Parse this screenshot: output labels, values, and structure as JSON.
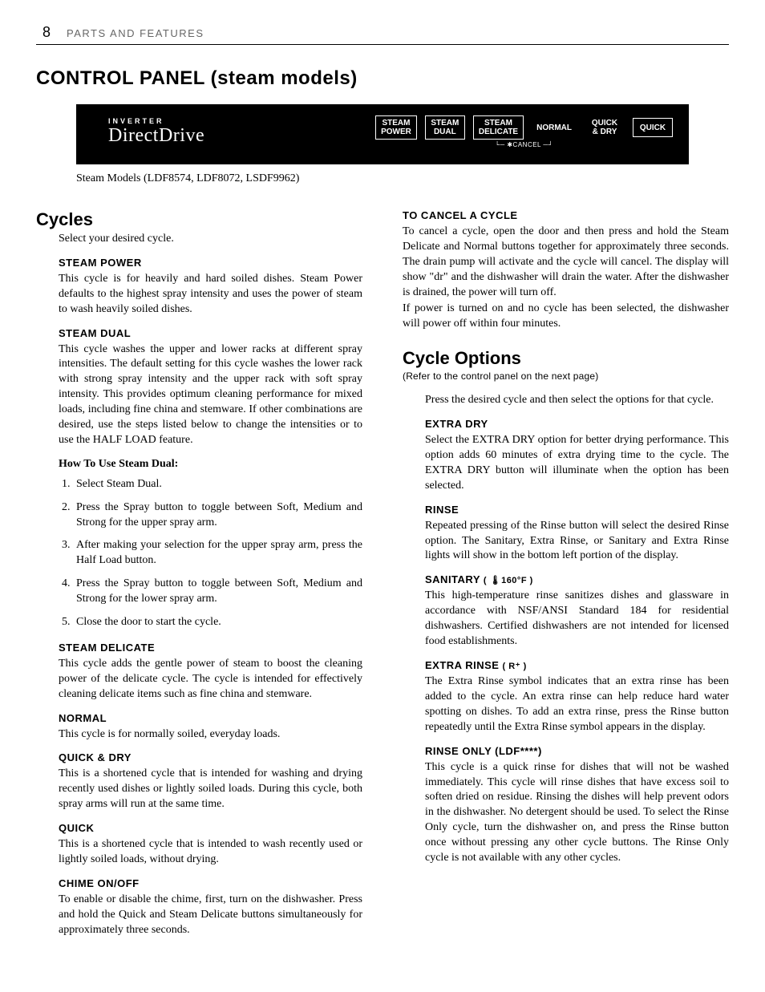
{
  "header": {
    "page_number": "8",
    "section": "PARTS AND FEATURES"
  },
  "title": "CONTROL PANEL (steam models)",
  "panel": {
    "brand_top": "INVERTER",
    "brand_main": "DirectDrive",
    "buttons": {
      "b1a": "STEAM",
      "b1b": "POWER",
      "b2a": "STEAM",
      "b2b": "DUAL",
      "b3a": "STEAM",
      "b3b": "DELICATE",
      "b4": "NORMAL",
      "b5a": "QUICK",
      "b5b": "& DRY",
      "b6": "QUICK"
    },
    "cancel": "✱CANCEL"
  },
  "caption": "Steam Models (LDF8574, LDF8072, LSDF9962)",
  "left": {
    "cycles_title": "Cycles",
    "cycles_intro": "Select your desired cycle.",
    "steam_power_h": "STEAM POWER",
    "steam_power_p": "This cycle is for heavily and hard soiled dishes. Steam Power defaults to the highest spray intensity and uses the power of steam to wash heavily soiled dishes.",
    "steam_dual_h": "STEAM DUAL",
    "steam_dual_p": "This cycle washes the upper and lower racks at different spray intensities. The default setting for this cycle washes the lower rack with strong spray intensity and the upper rack with soft spray intensity. This provides optimum cleaning performance for mixed loads, including fine china and stemware. If other combinations are desired, use the steps listed below to change the intensities or to use the HALF LOAD feature.",
    "howto_h": "How To Use Steam Dual:",
    "steps": {
      "s1": "Select Steam Dual.",
      "s2": "Press the Spray button to toggle between Soft, Medium and Strong for the upper spray arm.",
      "s3": "After making your selection for the upper spray arm, press the Half Load button.",
      "s4": "Press the Spray button to toggle between Soft, Medium and Strong for the lower spray arm.",
      "s5": "Close the door to start the cycle."
    },
    "steam_delicate_h": "STEAM DELICATE",
    "steam_delicate_p": "This cycle adds the gentle power of steam to boost the cleaning power of the delicate cycle. The cycle is intended for effectively cleaning delicate items such as fine china and stemware.",
    "normal_h": "NORMAL",
    "normal_p": "This cycle is for normally soiled, everyday loads.",
    "quickdry_h": "QUICK & DRY",
    "quickdry_p": "This is a shortened cycle that is intended for washing and drying recently used dishes or lightly soiled loads. During this cycle, both spray arms will run at the same time.",
    "quick_h": "QUICK",
    "quick_p": "This is a shortened cycle that is intended to wash recently used or lightly soiled loads, without drying.",
    "chime_h": "CHIME ON/OFF",
    "chime_p": "To enable or disable the chime, first, turn on the dishwasher. Press and hold the Quick and Steam Delicate buttons simultaneously for approximately three seconds."
  },
  "right": {
    "cancel_h": "TO CANCEL A CYCLE",
    "cancel_p1": "To cancel a cycle, open the door and then press and hold the Steam Delicate and Normal buttons together for approximately three seconds. The drain pump will activate and the cycle will cancel. The display will show \"dr\" and the dishwasher will drain the water. After the dishwasher is drained, the power will turn off.",
    "cancel_p2": "If power is turned on and no cycle has been selected, the dishwasher will power off within four minutes.",
    "options_title": "Cycle Options",
    "options_note": "(Refer to the control panel on the next page)",
    "options_intro": "Press the desired cycle and then select the options for that cycle.",
    "extradry_h": "EXTRA DRY",
    "extradry_p": "Select the EXTRA DRY option for better drying performance. This option adds 60 minutes of extra drying time to the cycle. The EXTRA DRY button will illuminate when the option has been selected.",
    "rinse_h": "RINSE",
    "rinse_p": "Repeated pressing of the Rinse button will select the desired Rinse option. The Sanitary, Extra Rinse, or Sanitary and Extra Rinse lights will show in the bottom left portion of the display.",
    "sanitary_h": "SANITARY",
    "sanitary_icon": "( 🌡160°F )",
    "sanitary_p": "This high-temperature rinse sanitizes dishes and glassware in accordance with NSF/ANSI Standard 184 for residential dishwashers. Certified dishwashers are not intended for licensed food establishments.",
    "extrarinse_h": "EXTRA RINSE",
    "extrarinse_icon": "(  R⁺  )",
    "extrarinse_p": "The Extra Rinse symbol indicates that an extra rinse has been added to the cycle. An extra rinse can help reduce hard water spotting on dishes. To add an extra rinse, press the Rinse button repeatedly until the Extra Rinse symbol appears in the display.",
    "rinseonly_h": "RINSE ONLY (LDF****)",
    "rinseonly_p": "This cycle is a quick rinse for dishes that will not be washed immediately. This cycle will rinse dishes that have excess soil to soften dried on residue. Rinsing the dishes will help prevent odors in the dishwasher. No detergent should be used. To select the Rinse Only cycle, turn the dishwasher on, and press the Rinse button once without pressing any other cycle buttons. The Rinse Only cycle is not available with any other cycles."
  }
}
